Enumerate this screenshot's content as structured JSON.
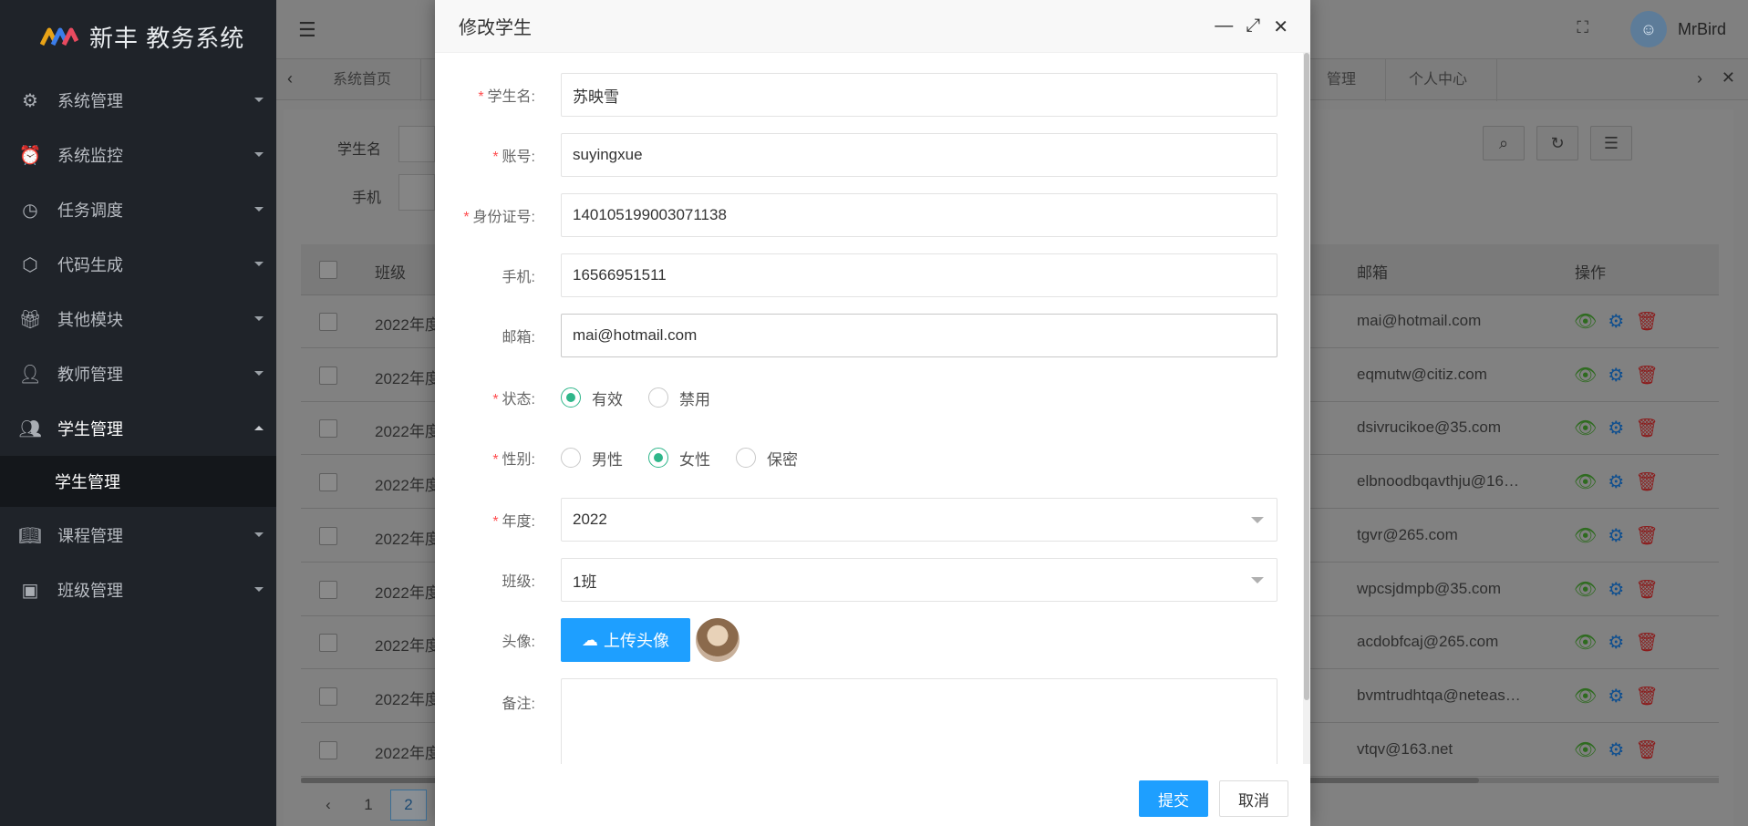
{
  "app": {
    "title": "新丰 教务系统"
  },
  "sidebar": {
    "items": [
      {
        "label": "系统管理",
        "icon": "gear-icon"
      },
      {
        "label": "系统监控",
        "icon": "alarm-icon"
      },
      {
        "label": "任务调度",
        "icon": "clock-icon"
      },
      {
        "label": "代码生成",
        "icon": "cube-icon"
      },
      {
        "label": "其他模块",
        "icon": "gift-icon"
      },
      {
        "label": "教师管理",
        "icon": "user-icon"
      },
      {
        "label": "学生管理",
        "icon": "users-icon"
      },
      {
        "label": "课程管理",
        "icon": "book-icon"
      },
      {
        "label": "班级管理",
        "icon": "wallet-icon"
      }
    ],
    "active_sub": "学生管理"
  },
  "header": {
    "username": "MrBird"
  },
  "tabs": [
    "系统首页",
    "管理",
    "个人中心"
  ],
  "filters": {
    "student_name_label": "学生名",
    "phone_label": "手机"
  },
  "table": {
    "columns": {
      "class": "班级",
      "email": "邮箱",
      "ops": "操作"
    },
    "rows": [
      {
        "class": "2022年度",
        "email": "mai@hotmail.com"
      },
      {
        "class": "2022年度",
        "email": "eqmutw@citiz.com"
      },
      {
        "class": "2022年度",
        "email": "dsivrucikoe@35.com"
      },
      {
        "class": "2022年度",
        "email": "elbnoodbqavthju@16…"
      },
      {
        "class": "2022年度",
        "email": "tgvr@265.com"
      },
      {
        "class": "2022年度",
        "email": "wpcsjdmpb@35.com"
      },
      {
        "class": "2022年度",
        "email": "acdobfcaj@265.com"
      },
      {
        "class": "2022年度",
        "email": "bvmtrudhtqa@neteas…"
      },
      {
        "class": "2022年度",
        "email": "vtqv@163.net"
      }
    ]
  },
  "pager": {
    "prev": "‹",
    "page1": "1",
    "page2": "2"
  },
  "modal": {
    "title": "修改学生",
    "fields": {
      "name_label": "学生名:",
      "name_value": "苏映雪",
      "account_label": "账号:",
      "account_value": "suyingxue",
      "idcard_label": "身份证号:",
      "idcard_value": "140105199003071138",
      "phone_label": "手机:",
      "phone_value": "16566951511",
      "email_label": "邮箱:",
      "email_value": "mai@hotmail.com",
      "status_label": "状态:",
      "status_valid": "有效",
      "status_disabled": "禁用",
      "gender_label": "性别:",
      "gender_male": "男性",
      "gender_female": "女性",
      "gender_secret": "保密",
      "year_label": "年度:",
      "year_value": "2022",
      "class_label": "班级:",
      "class_value": "1班",
      "avatar_label": "头像:",
      "upload_label": "上传头像",
      "remark_label": "备注:"
    },
    "submit": "提交",
    "cancel": "取消"
  },
  "colors": {
    "primary": "#1e9fff",
    "radio": "#2fb68a",
    "required": "#ff4d4f",
    "sidebar": "#1f2329"
  }
}
